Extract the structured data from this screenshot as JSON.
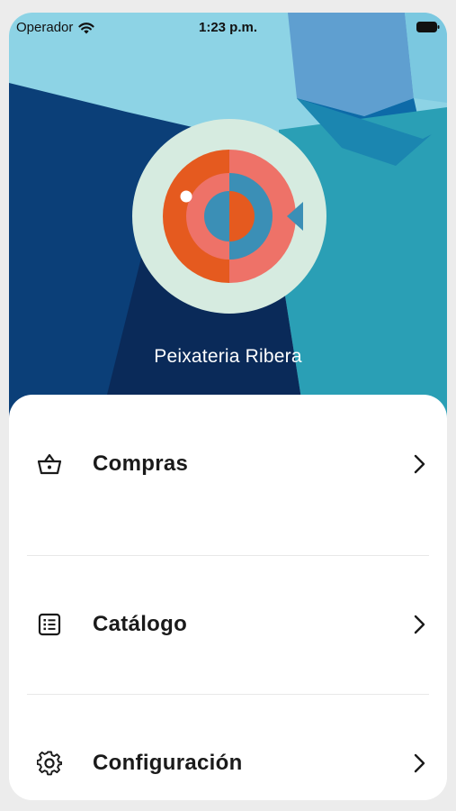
{
  "status_bar": {
    "carrier": "Operador",
    "time": "1:23 p.m."
  },
  "store": {
    "name": "Peixateria Ribera"
  },
  "menu": {
    "items": [
      {
        "label": "Compras",
        "icon": "basket-icon"
      },
      {
        "label": "Catálogo",
        "icon": "list-icon"
      },
      {
        "label": "Configuración",
        "icon": "gear-icon"
      }
    ]
  },
  "colors": {
    "hero_light_blue": "#8dd3e5",
    "hero_navy": "#0b3f78",
    "hero_dark_navy": "#0a2a59",
    "hero_teal": "#2a9fb5",
    "logo_bg": "#d6ebe0",
    "fish_orange": "#e55a1f",
    "fish_salmon": "#ee7268",
    "fish_blue": "#3b8fb6"
  }
}
